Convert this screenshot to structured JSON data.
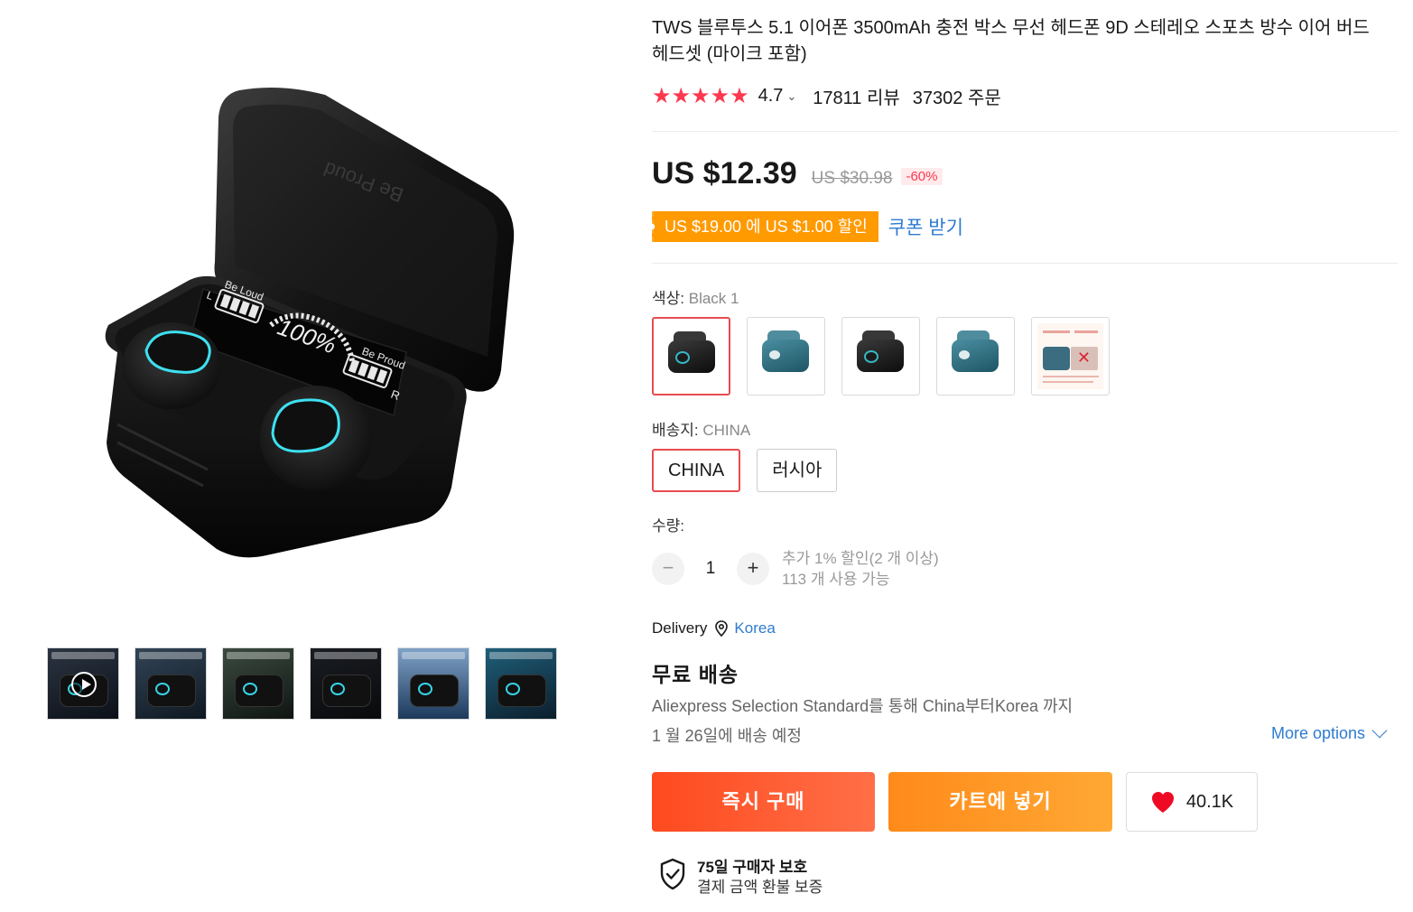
{
  "gallery": {
    "main_image": "tws-earbuds-charging-case-black",
    "case_text": {
      "lid_brand": "Be Proud",
      "top_label": "Be Loud",
      "bottom_label": "Be Proud",
      "percent": "100%",
      "left_mark": "L",
      "right_mark": "R"
    },
    "thumbnails": [
      {
        "name": "video-thumbnail",
        "has_play": true
      },
      {
        "name": "bluetooth-5-1-thumbnail",
        "has_play": false
      },
      {
        "name": "temperature-thumbnail",
        "has_play": false
      },
      {
        "name": "charge-cable-thumbnail",
        "has_play": false
      },
      {
        "name": "waterproof-thumbnail",
        "has_play": false
      },
      {
        "name": "lighting-thumbnail",
        "has_play": false
      }
    ]
  },
  "product": {
    "title": "TWS 블루투스 5.1 이어폰 3500mAh 충전 박스 무선 헤드폰 9D 스테레오 스포츠 방수 이어 버드 헤드셋 (마이크 포함)",
    "rating": "4.7",
    "reviews": "17811 리뷰",
    "orders": "37302 주문",
    "star_color": "#fd384f"
  },
  "price": {
    "current": "US $12.39",
    "original": "US $30.98",
    "discount": "-60%"
  },
  "coupon": {
    "tag": "US $19.00 에 US $1.00 할인",
    "link": "쿠폰 받기"
  },
  "color_option": {
    "label": "색상: ",
    "value": "Black 1",
    "swatches": [
      {
        "name": "swatch-black-1",
        "variant": "black",
        "selected": true
      },
      {
        "name": "swatch-teal-1",
        "variant": "teal",
        "selected": false
      },
      {
        "name": "swatch-black-2",
        "variant": "black",
        "selected": false
      },
      {
        "name": "swatch-teal-2",
        "variant": "teal",
        "selected": false
      },
      {
        "name": "swatch-instructions",
        "variant": "doc",
        "selected": false
      }
    ]
  },
  "ship_from": {
    "label": "배송지: ",
    "value": "CHINA",
    "options": [
      "CHINA",
      "러시아"
    ]
  },
  "quantity": {
    "label": "수량:",
    "minus": "−",
    "value": "1",
    "plus": "+",
    "note_discount": "추가 1% 할인(2 개 이상)",
    "note_available": "113 개 사용 가능"
  },
  "delivery": {
    "label": "Delivery",
    "destination": "Korea",
    "free_shipping": "무료 배송",
    "description": "Aliexpress Selection Standard를 통해 China부터Korea 까지",
    "estimate": "1 월 26일에 배송 예정",
    "more_options": "More options"
  },
  "actions": {
    "buy_now": "즉시 구매",
    "add_to_cart": "카트에 넣기",
    "wishlist_count": "40.1K",
    "heart_color": "#ee0a24"
  },
  "protection": {
    "title": "75일 구매자 보호",
    "subtitle": "결제 금액 환불 보증"
  }
}
